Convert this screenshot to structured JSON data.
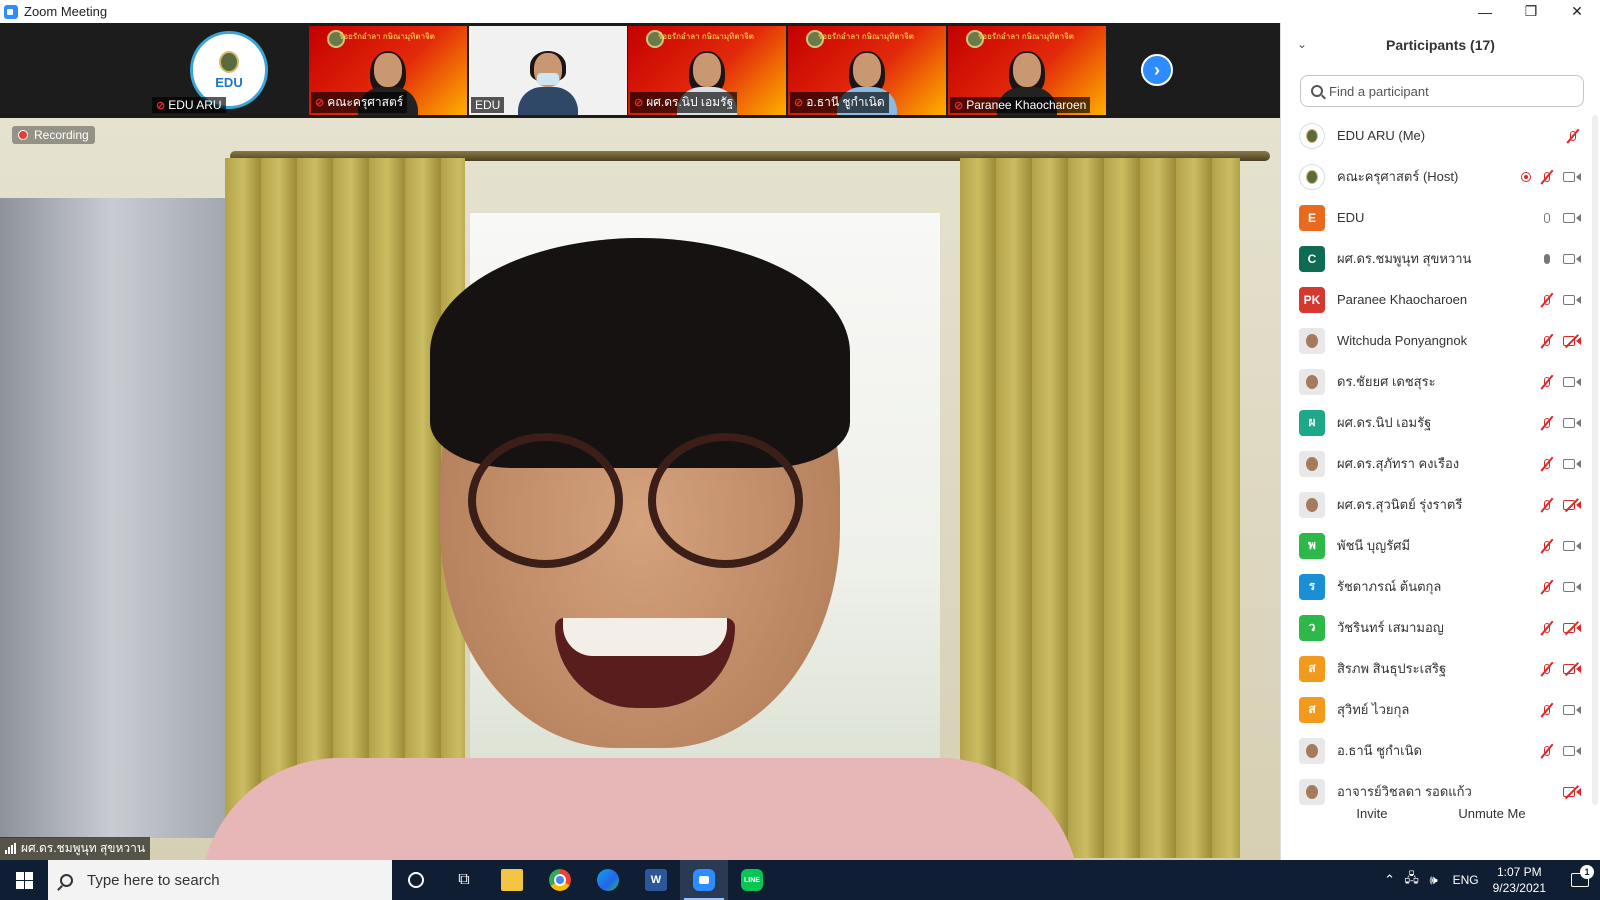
{
  "window": {
    "title": "Zoom Meeting",
    "minimize": "—",
    "restore": "❐",
    "close": "✕"
  },
  "strip": {
    "thumbnails": [
      {
        "name": "EDU ARU",
        "muted": true,
        "type": "logo",
        "logo_text": "EDU"
      },
      {
        "name": "คณะครุศาสตร์",
        "muted": true,
        "type": "red",
        "banner": "ร้อยรักอำลา กษิณามุทิตาจิต"
      },
      {
        "name": "EDU",
        "muted": false,
        "type": "white"
      },
      {
        "name": "ผศ.ดร.นิป เอมรัฐ",
        "muted": true,
        "type": "red",
        "banner": "ร้อยรักอำลา กษิณามุทิตาจิต"
      },
      {
        "name": "อ.ธานี ชูกำเนิด",
        "muted": true,
        "type": "red",
        "banner": "ร้อยรักอำลา กษิณามุทิตาจิต"
      },
      {
        "name": "Paranee Khaocharoen",
        "muted": true,
        "type": "red",
        "banner": "ร้อยรักอำลา กษิณามุทิตาจิต"
      }
    ],
    "next_icon": "›"
  },
  "main": {
    "recording_label": "Recording",
    "speaker_name": "ผศ.ดร.ชมพูนุท สุขหวาน"
  },
  "panel": {
    "title": "Participants (17)",
    "collapse_icon": "⌄",
    "search_placeholder": "Find a participant",
    "participants": [
      {
        "name": "EDU ARU (Me)",
        "avatar": "logo",
        "avatar_color": "#ffffff",
        "initials": "",
        "recording": false,
        "mic": "muted",
        "cam": "none"
      },
      {
        "name": "คณะครุศาสตร์ (Host)",
        "avatar": "logo",
        "avatar_color": "#ffffff",
        "initials": "",
        "recording": true,
        "mic": "muted",
        "cam": "on"
      },
      {
        "name": "EDU",
        "avatar": "initial",
        "avatar_color": "#e86a1f",
        "initials": "E",
        "recording": false,
        "mic": "on",
        "cam": "on"
      },
      {
        "name": "ผศ.ดร.ชมพูนุท สุขหวาน",
        "avatar": "initial",
        "avatar_color": "#0f6b53",
        "initials": "C",
        "recording": false,
        "mic": "active",
        "cam": "on"
      },
      {
        "name": "Paranee Khaocharoen",
        "avatar": "initial",
        "avatar_color": "#d4382f",
        "initials": "PK",
        "recording": false,
        "mic": "muted",
        "cam": "on"
      },
      {
        "name": "Witchuda Ponyangnok",
        "avatar": "photo",
        "avatar_color": "#e8e8e8",
        "initials": "",
        "recording": false,
        "mic": "muted",
        "cam": "off"
      },
      {
        "name": "ดร.ชัยยศ เดชสุระ",
        "avatar": "photo",
        "avatar_color": "#e8e8e8",
        "initials": "",
        "recording": false,
        "mic": "muted",
        "cam": "on"
      },
      {
        "name": "ผศ.ดร.นิป เอมรัฐ",
        "avatar": "initial",
        "avatar_color": "#1ea88a",
        "initials": "ผ",
        "recording": false,
        "mic": "muted",
        "cam": "on"
      },
      {
        "name": "ผศ.ดร.สุภัทรา คงเรือง",
        "avatar": "photo",
        "avatar_color": "#e8e8e8",
        "initials": "",
        "recording": false,
        "mic": "muted",
        "cam": "on"
      },
      {
        "name": "ผศ.ดร.สุวนิตย์ รุ่งราตรี",
        "avatar": "photo",
        "avatar_color": "#e8e8e8",
        "initials": "",
        "recording": false,
        "mic": "muted",
        "cam": "off"
      },
      {
        "name": "พัชนี บุญรัศมี",
        "avatar": "initial",
        "avatar_color": "#2eb84a",
        "initials": "พ",
        "recording": false,
        "mic": "muted",
        "cam": "on"
      },
      {
        "name": "รัชดาภรณ์ ต้นตกุล",
        "avatar": "initial",
        "avatar_color": "#1a8fd6",
        "initials": "ร",
        "recording": false,
        "mic": "muted",
        "cam": "on"
      },
      {
        "name": "วัชรินทร์ เสมามอญ",
        "avatar": "initial",
        "avatar_color": "#2eb84a",
        "initials": "ว",
        "recording": false,
        "mic": "muted",
        "cam": "off"
      },
      {
        "name": "สิรภพ สินธุประเสริฐ",
        "avatar": "initial",
        "avatar_color": "#f29a1b",
        "initials": "ส",
        "recording": false,
        "mic": "muted",
        "cam": "off"
      },
      {
        "name": "สุวิทย์ ไวยกุล",
        "avatar": "initial",
        "avatar_color": "#f29a1b",
        "initials": "ส",
        "recording": false,
        "mic": "muted",
        "cam": "on"
      },
      {
        "name": "อ.ธานี ชูกำเนิด",
        "avatar": "photo",
        "avatar_color": "#e8e8e8",
        "initials": "",
        "recording": false,
        "mic": "muted",
        "cam": "on"
      },
      {
        "name": "อาจารย์วิชลดา รอดแก้ว",
        "avatar": "photo",
        "avatar_color": "#e8e8e8",
        "initials": "",
        "recording": false,
        "mic": "none",
        "cam": "off"
      }
    ],
    "invite_label": "Invite",
    "unmute_label": "Unmute Me"
  },
  "taskbar": {
    "search_placeholder": "Type here to search",
    "apps": [
      {
        "name": "cortana-icon",
        "glyph": "○",
        "active": false
      },
      {
        "name": "task-view-icon",
        "glyph": "⧉",
        "active": false
      },
      {
        "name": "file-explorer-icon",
        "glyph": "",
        "active": false
      },
      {
        "name": "chrome-icon",
        "glyph": "",
        "active": false
      },
      {
        "name": "edge-icon",
        "glyph": "",
        "active": false
      },
      {
        "name": "word-icon",
        "glyph": "W",
        "active": false
      },
      {
        "name": "zoom-icon",
        "glyph": "",
        "active": true
      },
      {
        "name": "line-icon",
        "glyph": "LINE",
        "active": false
      }
    ],
    "language": "ENG",
    "time": "1:07 PM",
    "date": "9/23/2021",
    "notification_count": "1"
  },
  "colors": {
    "zoom_blue": "#2d8cff",
    "muted_red": "#e02828",
    "taskbar": "#0f1e33"
  }
}
